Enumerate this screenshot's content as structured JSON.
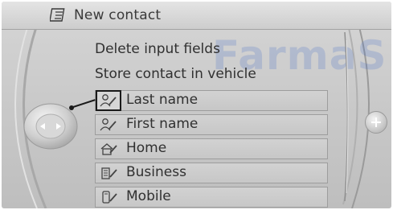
{
  "header": {
    "title": "New contact",
    "icon": "contact-card-icon"
  },
  "watermark": "FarmaS",
  "menu": {
    "actions": [
      {
        "label": "Delete input fields"
      },
      {
        "label": "Store contact in vehicle"
      }
    ],
    "fields": [
      {
        "label": "Last name",
        "icon": "person-edit-icon",
        "selected": true
      },
      {
        "label": "First name",
        "icon": "person-edit-icon",
        "selected": false
      },
      {
        "label": "Home",
        "icon": "home-edit-icon",
        "selected": false
      },
      {
        "label": "Business",
        "icon": "business-edit-icon",
        "selected": false
      },
      {
        "label": "Mobile",
        "icon": "mobile-edit-icon",
        "selected": false
      }
    ]
  },
  "controls": {
    "controller_icon": "controller-left-right-icon",
    "plus_icon": "plus-icon"
  },
  "colors": {
    "background": "#c9c9c9",
    "text": "#303030",
    "selection": "#1a1a1a",
    "watermark": "#466ec8"
  }
}
